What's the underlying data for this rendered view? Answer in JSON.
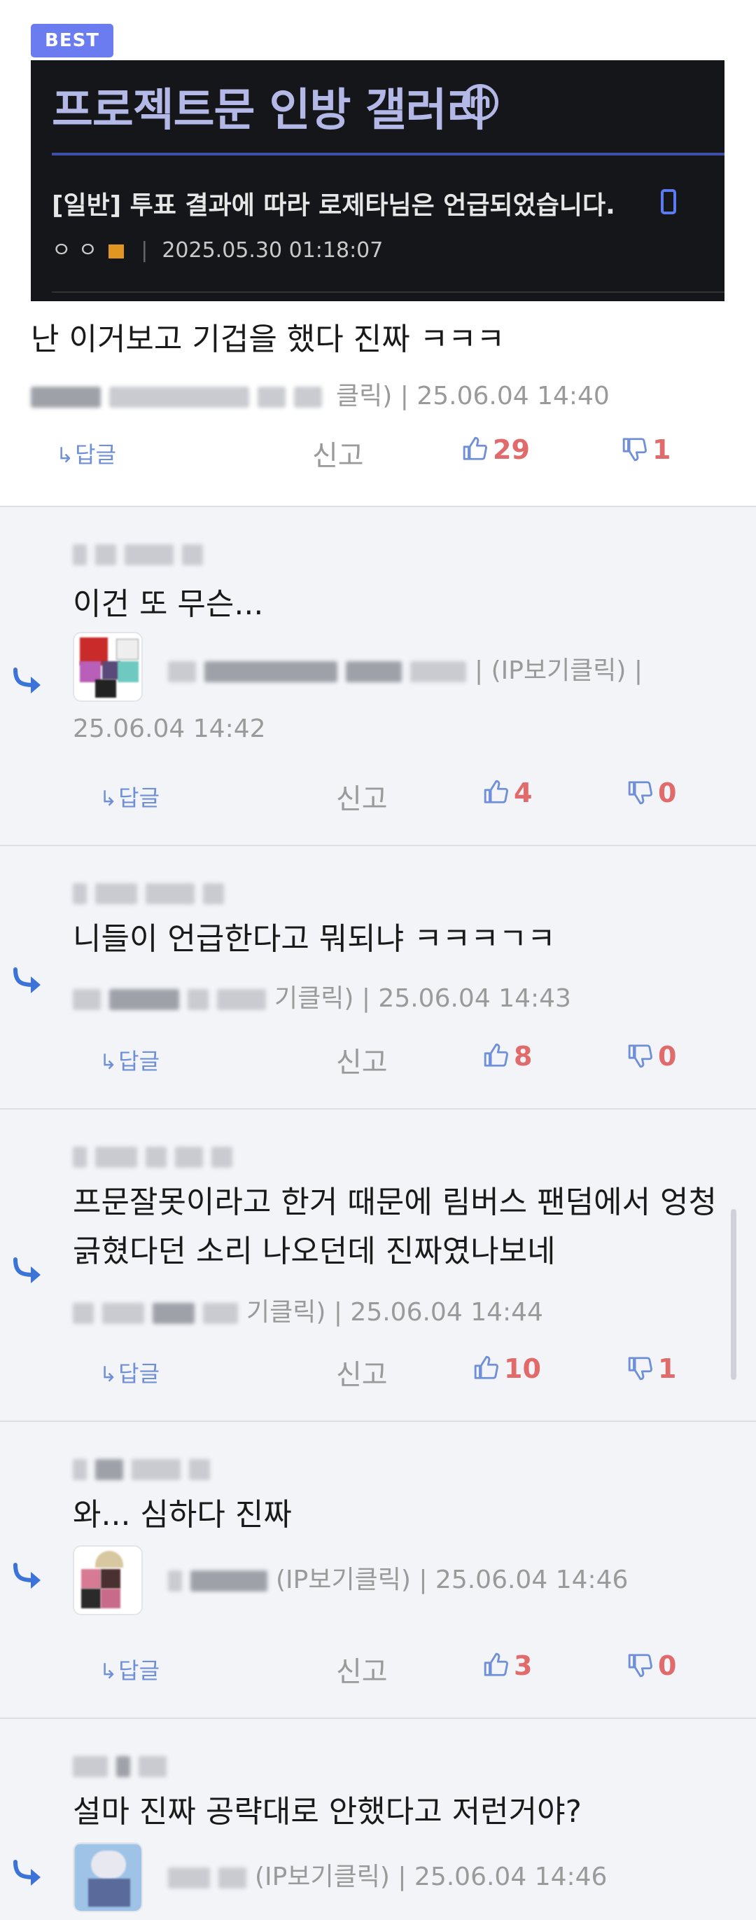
{
  "best": {
    "badge": "BEST",
    "thumbnail": {
      "gallery_title": "프로젝트문 인방 갤러리",
      "gallery_mark": "m",
      "post_title": "[일반] 투표 결과에 따라 로제타님은 언급되었습니다.",
      "post_author": "ㅇㅇ",
      "post_datetime": "2025.05.30 01:18:07"
    },
    "comment": {
      "text": "난 이거보고 기겁을 했다 진짜 ㅋㅋㅋ",
      "ip_label": "클릭)",
      "datetime": "| 25.06.04 14:40",
      "reply": "답글",
      "report": "신고",
      "up": "29",
      "down": "1"
    }
  },
  "replies": [
    {
      "text": "이건 또 무슨...",
      "ip_label": "| (IP보기클릭) |",
      "datetime": "25.06.04 14:42",
      "reply": "답글",
      "report": "신고",
      "up": "4",
      "down": "0"
    },
    {
      "text": "니들이 언급한다고 뭐되냐 ㅋㅋㅋㄱㅋ",
      "ip_label": "기클릭)",
      "datetime": "| 25.06.04 14:43",
      "reply": "답글",
      "report": "신고",
      "up": "8",
      "down": "0"
    },
    {
      "text_line1": "프문잘못이라고 한거 때문에 림버스 팬덤에서 엉청",
      "text_line2": "긁혔다던 소리 나오던데 진짜였나보네",
      "ip_label": "기클릭)",
      "datetime": "| 25.06.04 14:44",
      "reply": "답글",
      "report": "신고",
      "up": "10",
      "down": "1"
    },
    {
      "text": "와... 심하다 진짜",
      "ip_label": "(IP보기클릭)",
      "datetime": "| 25.06.04 14:46",
      "reply": "답글",
      "report": "신고",
      "up": "3",
      "down": "0"
    },
    {
      "text": "설마 진짜 공략대로 안했다고 저런거야?",
      "ip_label": "(IP보기클릭)",
      "datetime": "| 25.06.04 14:46"
    }
  ],
  "colors": {
    "best_badge": "#6a7cf0",
    "action_count": "#e16a6a",
    "reply_link": "#6f8fd8",
    "reply_arrow": "#3b73d9"
  }
}
